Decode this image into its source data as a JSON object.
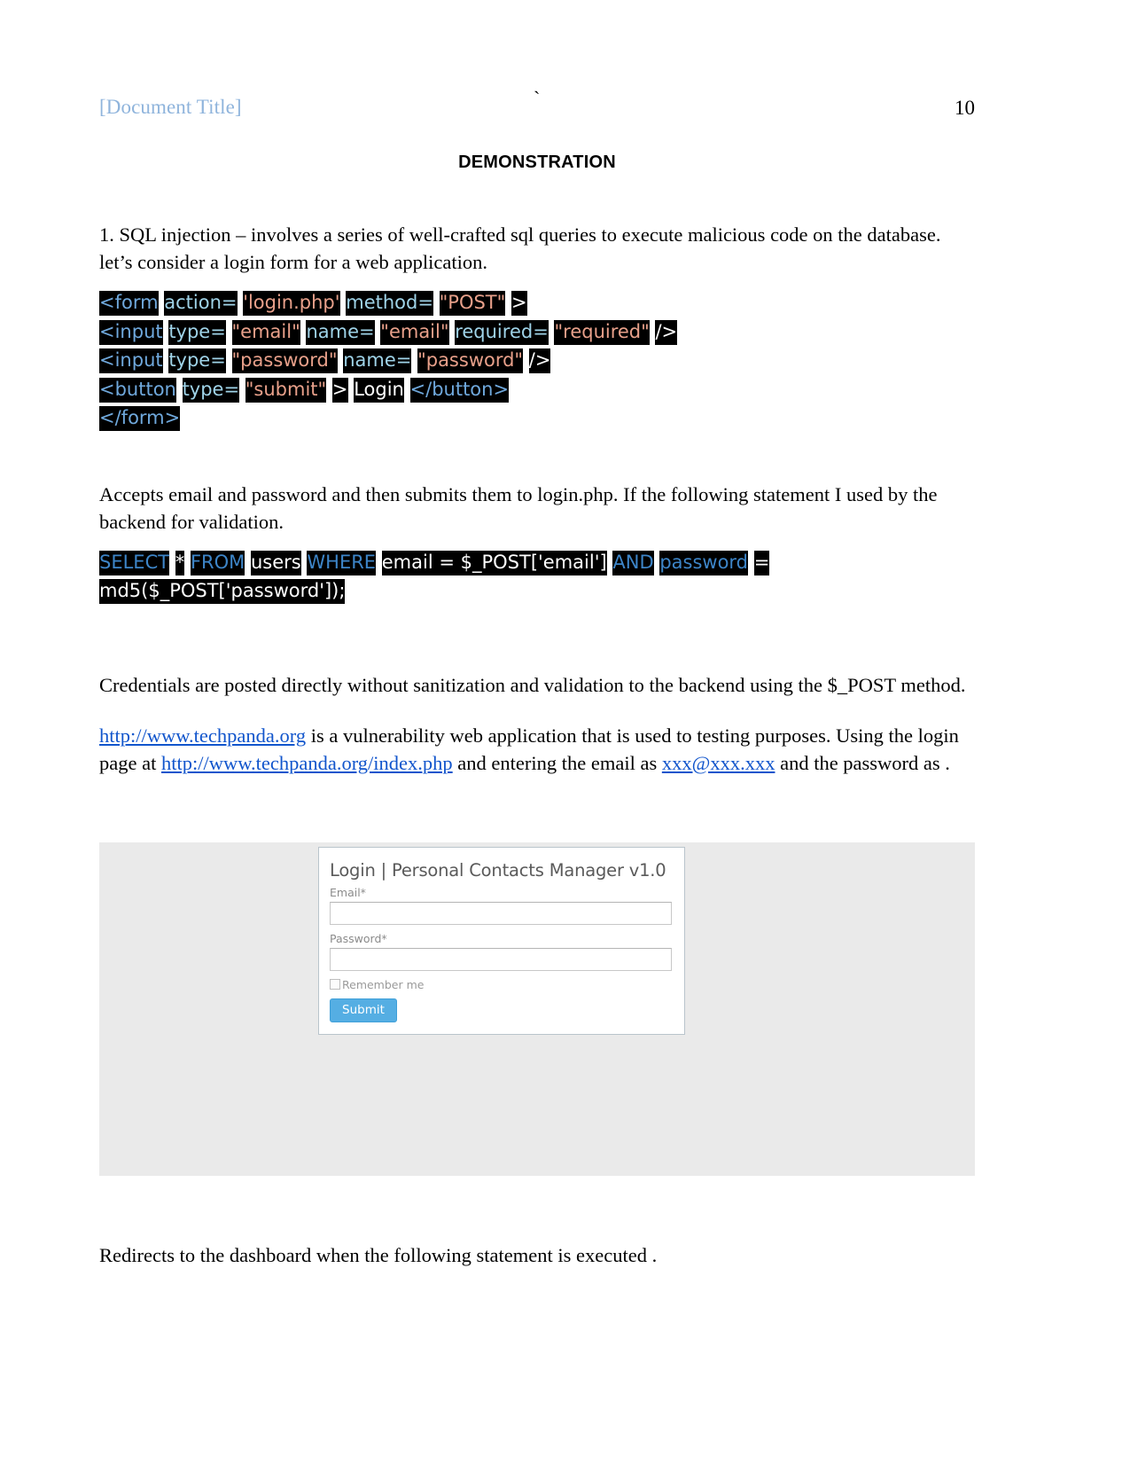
{
  "header": {
    "document_title": "[Document Title]",
    "center_mark": "`",
    "page_number": "10"
  },
  "section_heading": "DEMONSTRATION",
  "intro_paragraph": "1. SQL injection – involves a series of well-crafted sql queries to execute malicious code on the database. let’s consider a login form for a web application.",
  "html_code": {
    "line1": {
      "tag_open": "<form",
      "attr_action": "action=",
      "val_action": "'login.php'",
      "attr_method": "method=",
      "val_method": "\"POST\"",
      "close": ">"
    },
    "line2": {
      "tag_open": "<input",
      "attr_type": "type=",
      "val_type": "\"email\"",
      "attr_name": "name=",
      "val_name": "\"email\"",
      "attr_required": "required=",
      "val_required": "\"required\"",
      "close": "/>"
    },
    "line3": {
      "tag_open": "<input",
      "attr_type": "type=",
      "val_type": "\"password\"",
      "attr_name": "name=",
      "val_name": "\"password\"",
      "close": "/>"
    },
    "line4": {
      "tag_open": "<button",
      "attr_type": "type=",
      "val_type": "\"submit\"",
      "close": ">",
      "text": "Login",
      "tag_close": "</button>"
    },
    "line5": {
      "tag_close": "</form>"
    }
  },
  "middle_paragraph": "Accepts email and password and then submits them to login.php. If the following statement I used by the backend for validation.",
  "sql_code": {
    "kw_select": "SELECT",
    "star": "*",
    "kw_from": "FROM",
    "table": "users",
    "kw_where": "WHERE",
    "cond_email": "email = $_POST['email']",
    "kw_and": "AND",
    "kw_password": "password",
    "equals": "=",
    "line2": "md5($_POST['password']);"
  },
  "credentials_paragraph": "Credentials are posted directly without sanitization and validation to the backend using the $_POST method.",
  "links_paragraph": {
    "link_site": "http://www.techpanda.org",
    "text_1": " is a vulnerability web application that is used to testing purposes. Using the login page at ",
    "link_index": "http://www.techpanda.org/index.php",
    "text_2": " and entering the email as ",
    "link_email": "xxx@xxx.xxx",
    "text_3": " and the password as ."
  },
  "login_screenshot": {
    "title": "Login | Personal Contacts Manager v1.0",
    "email_label": "Email*",
    "email_value": "",
    "email_placeholder": "",
    "password_label": "Password*",
    "password_value": "",
    "password_placeholder": "",
    "remember_label": "Remember me",
    "submit_label": "Submit",
    "accent_color": "#55AEE3",
    "background_color": "#EAEAEA"
  },
  "closing_paragraph": "Redirects to the dashboard when  the following statement is executed ."
}
